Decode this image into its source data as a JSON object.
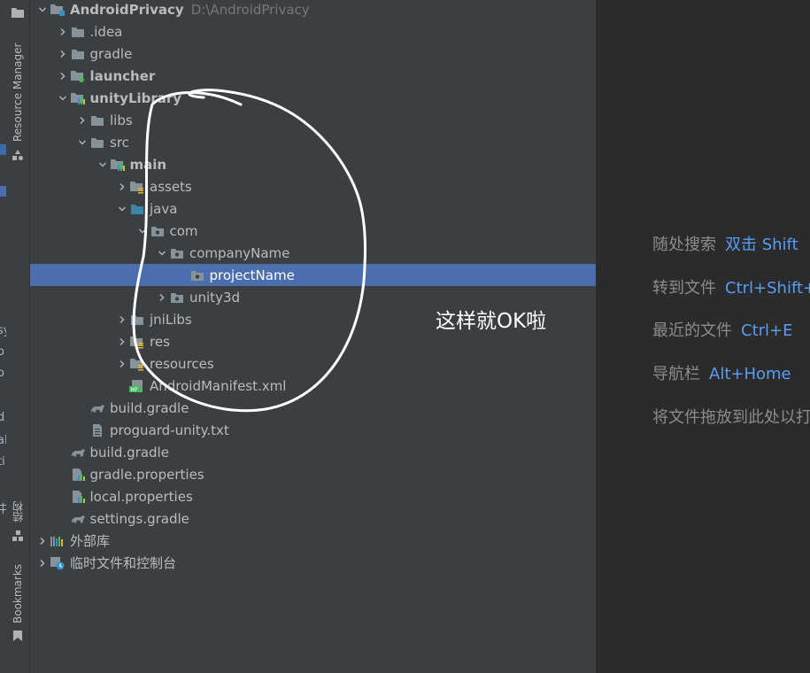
{
  "left_fragments": [
    "sy",
    "o",
    "o",
    "d",
    "al",
    "ti",
    "中"
  ],
  "tool_stripe": {
    "resource_manager": "Resource Manager",
    "structure": "结构",
    "bookmarks": "Bookmarks"
  },
  "tree": [
    {
      "name": "AndroidPrivacy",
      "path": "D:\\AndroidPrivacy",
      "bold": true,
      "expanded": true,
      "icon": "module-folder-icon"
    },
    {
      "name": ".idea",
      "expanded": false,
      "icon": "folder-icon"
    },
    {
      "name": "gradle",
      "expanded": false,
      "icon": "folder-icon"
    },
    {
      "name": "launcher",
      "bold": true,
      "expanded": false,
      "icon": "app-module-icon"
    },
    {
      "name": "unityLibrary",
      "bold": true,
      "expanded": true,
      "icon": "library-module-icon"
    },
    {
      "name": "libs",
      "expanded": false,
      "icon": "folder-icon"
    },
    {
      "name": "src",
      "expanded": true,
      "icon": "folder-icon"
    },
    {
      "name": "main",
      "bold": true,
      "expanded": true,
      "icon": "source-set-icon"
    },
    {
      "name": "assets",
      "expanded": false,
      "icon": "resources-folder-icon"
    },
    {
      "name": "java",
      "expanded": true,
      "icon": "source-root-icon"
    },
    {
      "name": "com",
      "expanded": true,
      "icon": "package-icon"
    },
    {
      "name": "companyName",
      "expanded": true,
      "icon": "package-icon"
    },
    {
      "name": "projectName",
      "selected": true,
      "icon": "package-icon"
    },
    {
      "name": "unity3d",
      "expanded": false,
      "icon": "package-icon"
    },
    {
      "name": "jniLibs",
      "expanded": false,
      "icon": "folder-icon"
    },
    {
      "name": "res",
      "expanded": false,
      "icon": "resources-folder-icon"
    },
    {
      "name": "resources",
      "expanded": false,
      "icon": "resources-folder-icon"
    },
    {
      "name": "AndroidManifest.xml",
      "icon": "manifest-icon"
    },
    {
      "name": "build.gradle",
      "icon": "gradle-icon"
    },
    {
      "name": "proguard-unity.txt",
      "icon": "text-file-icon"
    },
    {
      "name": "build.gradle",
      "icon": "gradle-icon"
    },
    {
      "name": "gradle.properties",
      "icon": "properties-icon"
    },
    {
      "name": "local.properties",
      "icon": "properties-icon"
    },
    {
      "name": "settings.gradle",
      "icon": "gradle-icon"
    },
    {
      "name": "外部库",
      "expanded": false,
      "icon": "libraries-icon"
    },
    {
      "name": "临时文件和控制台",
      "expanded": false,
      "icon": "scratches-icon"
    }
  ],
  "editor_hints": [
    {
      "label": "随处搜索",
      "key": "双击 Shift"
    },
    {
      "label": "转到文件",
      "key": "Ctrl+Shift+N"
    },
    {
      "label": "最近的文件",
      "key": "Ctrl+E"
    },
    {
      "label": "导航栏",
      "key": "Alt+Home"
    },
    {
      "label": "将文件拖放到此处以打开",
      "key": ""
    }
  ],
  "annotation": "这样就OK啦",
  "colors": {
    "selection": "#4b6eaf",
    "panel": "#3c3f41",
    "editor": "#2b2b2b",
    "key_link": "#589df6"
  }
}
